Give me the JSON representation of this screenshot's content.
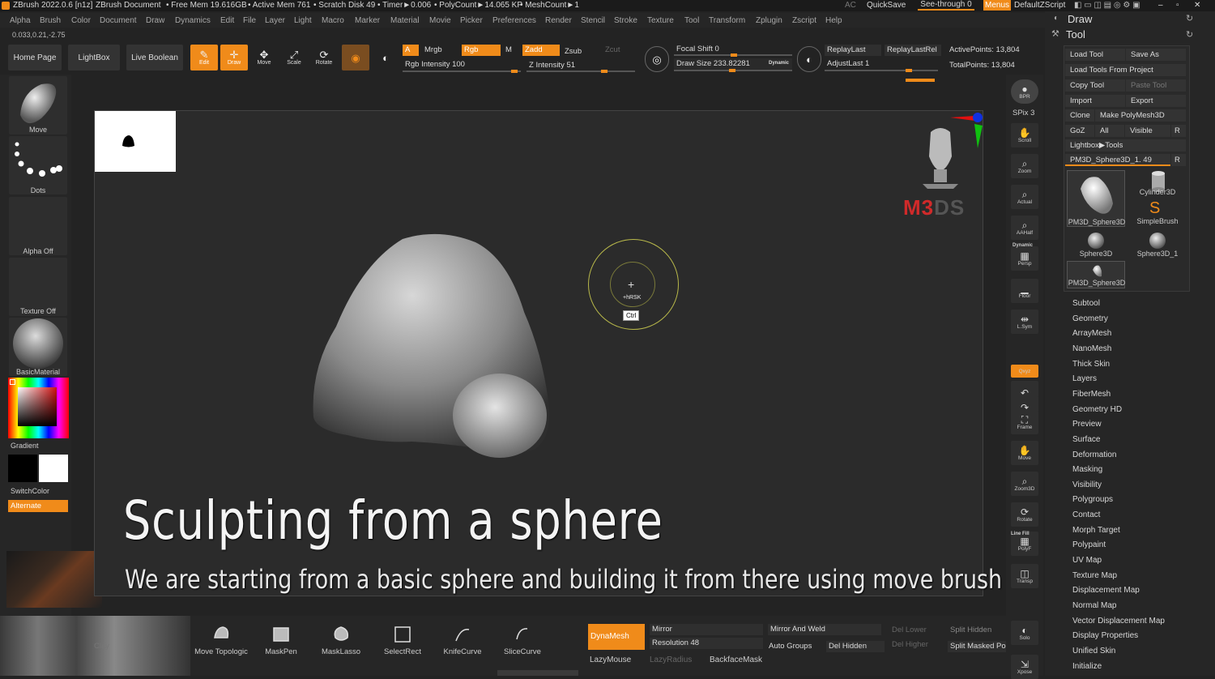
{
  "titlebar": {
    "app": "ZBrush 2022.0.6 [n1z]",
    "doc": "ZBrush Document",
    "free_mem": "• Free Mem 19.616GB",
    "active_mem": "• Active Mem 761",
    "scratch": "• Scratch Disk 49",
    "timer": "• Timer►0.006",
    "polycount": "• PolyCount►14.065 KP",
    "meshcount": "• MeshCount►1",
    "ac": "AC",
    "quicksave": "QuickSave",
    "seethrough": "See-through  0",
    "menus": "Menus",
    "script": "DefaultZScript"
  },
  "menubar": [
    "Alpha",
    "Brush",
    "Color",
    "Document",
    "Draw",
    "Dynamics",
    "Edit",
    "File",
    "Layer",
    "Light",
    "Macro",
    "Marker",
    "Material",
    "Movie",
    "Picker",
    "Preferences",
    "Render",
    "Stencil",
    "Stroke",
    "Texture",
    "Tool",
    "Transform",
    "Zplugin",
    "Zscript",
    "Help"
  ],
  "coords": "0.033,0.21,-2.75",
  "toolbar": {
    "home": "Home Page",
    "lightbox": "LightBox",
    "liveboolean": "Live Boolean",
    "edit": "Edit",
    "draw": "Draw",
    "move": "Move",
    "scale": "Scale",
    "rotate": "Rotate",
    "a": "A",
    "mrgb": "Mrgb",
    "rgb": "Rgb",
    "m": "M",
    "zadd": "Zadd",
    "zsub": "Zsub",
    "zcut": "Zcut",
    "rgb_intensity": "Rgb Intensity 100",
    "z_intensity": "Z Intensity 51",
    "focal_shift": "Focal Shift 0",
    "draw_size": "Draw Size 233.82281",
    "dynamic": "Dynamic",
    "replaylast": "ReplayLast",
    "replaylastrel": "ReplayLastRel",
    "adjustlast": "AdjustLast 1",
    "active_points": "ActivePoints: 13,804",
    "total_points": "TotalPoints: 13,804"
  },
  "left": {
    "brush": "Move",
    "stroke": "Dots",
    "alpha": "Alpha Off",
    "texture": "Texture Off",
    "material": "BasicMaterial",
    "gradient": "Gradient",
    "switchcolor": "SwitchColor",
    "alternate": "Alternate"
  },
  "canvas": {
    "cursor_label": "+hRSK",
    "ctrl": "Ctrl",
    "logo": "M3DS",
    "caption_title": "Sculpting from a sphere",
    "caption_sub": "We are starting from a basic sphere and building it from there using move brush"
  },
  "shelf": [
    "BPR",
    "SPix 3",
    "Scroll",
    "Zoom",
    "Actual",
    "AAHalf",
    "Persp",
    "Floor",
    "L.Sym",
    "",
    "Qxyz",
    "",
    "",
    "Frame",
    "Move",
    "Zoom3D",
    "Rotate",
    "PolyF",
    "Transp",
    "",
    "Solo",
    "Xpose"
  ],
  "shelf_extra": {
    "dynamic": "Dynamic",
    "linefill": "Line Fill",
    "spix": "SPix 3"
  },
  "right": {
    "draw": "Draw",
    "tool": "Tool",
    "load_tool": "Load Tool",
    "save_as": "Save As",
    "load_from_project": "Load Tools From Project",
    "copy_tool": "Copy Tool",
    "paste_tool": "Paste Tool",
    "import": "Import",
    "export": "Export",
    "clone": "Clone",
    "make_polymesh": "Make PolyMesh3D",
    "goz": "GoZ",
    "all": "All",
    "visible": "Visible",
    "r": "R",
    "lightbox_tools": "Lightbox▶Tools",
    "current_tool": "PM3D_Sphere3D_1. 49",
    "thumbs": [
      "PM3D_Sphere3D",
      "Cylinder3D",
      "SimpleBrush",
      "Sphere3D",
      "Sphere3D_1",
      "PM3D_Sphere3D"
    ],
    "menu": [
      "Subtool",
      "Geometry",
      "ArrayMesh",
      "NanoMesh",
      "Thick Skin",
      "Layers",
      "FiberMesh",
      "Geometry HD",
      "Preview",
      "Surface",
      "Deformation",
      "Masking",
      "Visibility",
      "Polygroups",
      "Contact",
      "Morph Target",
      "Polypaint",
      "UV Map",
      "Texture Map",
      "Displacement Map",
      "Normal Map",
      "Vector Displacement Map",
      "Display Properties",
      "Unified Skin",
      "Initialize"
    ]
  },
  "bottom": {
    "brushes": [
      "Move Topologic",
      "MaskPen",
      "MaskLasso",
      "SelectRect",
      "KnifeCurve",
      "SliceCurve"
    ],
    "clay": "Clay",
    "dynamesh": "DynaMesh",
    "lazymouse": "LazyMouse",
    "lazyradius": "LazyRadius",
    "mirror": "Mirror",
    "resolution": "Resolution 48",
    "mirror_weld": "Mirror And Weld",
    "auto_groups": "Auto Groups",
    "del_hidden": "Del Hidden",
    "del_lower": "Del Lower",
    "del_higher": "Del Higher",
    "split_hidden": "Split Hidden",
    "split_masked": "Split Masked Po",
    "backface": "BackfaceMask"
  },
  "colors": {
    "accent": "#f08b1a",
    "bg": "#232323",
    "panel": "#262626"
  }
}
